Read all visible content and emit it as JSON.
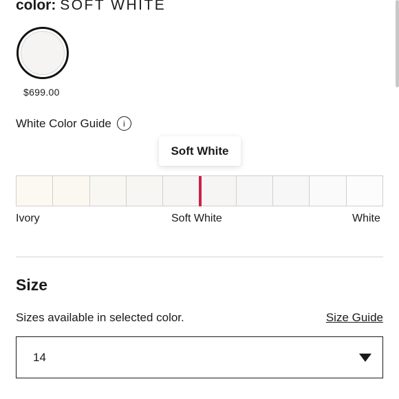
{
  "color": {
    "label": "color:",
    "value": "SOFT WHITE",
    "swatch_color": "#f5f4f2"
  },
  "price": "$699.00",
  "guide": {
    "title": "White Color Guide",
    "info_glyph": "i",
    "tooltip": "Soft White",
    "selected_index": 5,
    "marker_color": "#cc1f47",
    "shades": [
      "#fbf9f1",
      "#faf8f0",
      "#f9f7f2",
      "#f7f6f3",
      "#f6f5f3",
      "#f6f5f4",
      "#f7f6f6",
      "#f8f7f7",
      "#fafafa",
      "#fcfcfc"
    ],
    "labels": {
      "left": "Ivory",
      "middle": "Soft White",
      "right": "White"
    }
  },
  "size": {
    "title": "Size",
    "subtitle": "Sizes available in selected color.",
    "guide_link": "Size Guide",
    "selected": "14"
  }
}
